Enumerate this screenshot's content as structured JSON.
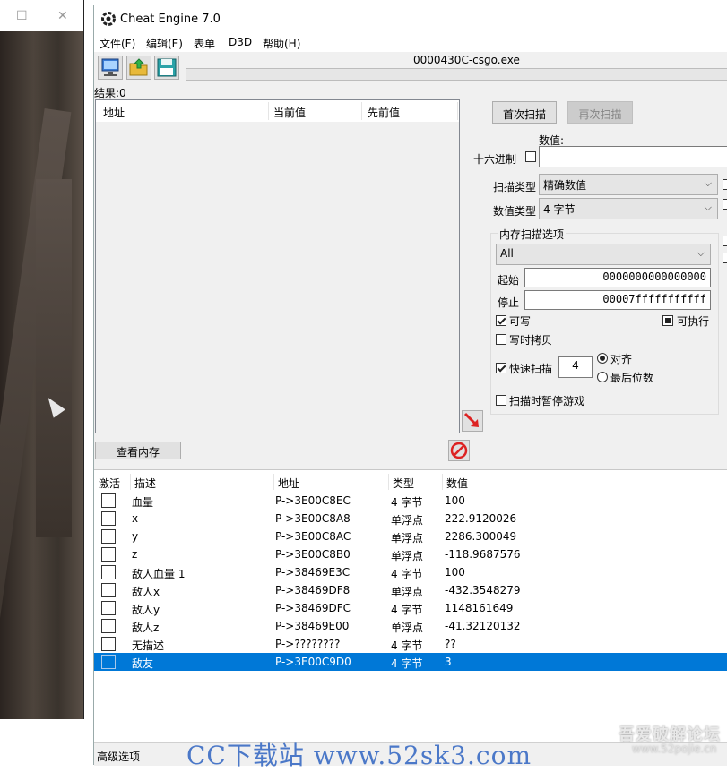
{
  "window": {
    "title": "Cheat Engine 7.0",
    "process": "0000430C-csgo.exe"
  },
  "menu": [
    "文件(F)",
    "编辑(E)",
    "表单",
    "D3D",
    "帮助(H)"
  ],
  "results_label": "结果:0",
  "found_list": {
    "columns": [
      "地址",
      "当前值",
      "先前值"
    ]
  },
  "view_memory_label": "查看内存",
  "scan": {
    "first_scan": "首次扫描",
    "next_scan": "再次扫描",
    "value_label": "数值:",
    "hex_label": "十六进制",
    "hex_checked": false,
    "value": "",
    "scan_type_label": "扫描类型",
    "scan_type": "精确数值",
    "value_type_label": "数值类型",
    "value_type": "4 字节",
    "memory_group_title": "内存扫描选项",
    "region": "All",
    "start_label": "起始",
    "start_value": "0000000000000000",
    "stop_label": "停止",
    "stop_value": "00007fffffffffff",
    "writable_label": "可写",
    "writable": true,
    "executable_label": "可执行",
    "executable": "partial",
    "copy_on_write_label": "写时拷贝",
    "copy_on_write": false,
    "fast_scan_label": "快速扫描",
    "fast_scan": true,
    "fast_scan_value": "4",
    "align_label": "对齐",
    "last_digits_label": "最后位数",
    "alignment_selected": "对齐",
    "pause_label": "扫描时暂停游戏",
    "pause": false
  },
  "address_list": {
    "columns": [
      "激活",
      "描述",
      "地址",
      "类型",
      "数值"
    ],
    "rows": [
      {
        "active": false,
        "desc": "血量",
        "address": "P->3E00C8EC",
        "type": "4 字节",
        "value": "100"
      },
      {
        "active": false,
        "desc": "x",
        "address": "P->3E00C8A8",
        "type": "单浮点",
        "value": "222.9120026"
      },
      {
        "active": false,
        "desc": "y",
        "address": "P->3E00C8AC",
        "type": "单浮点",
        "value": "2286.300049"
      },
      {
        "active": false,
        "desc": "z",
        "address": "P->3E00C8B0",
        "type": "单浮点",
        "value": "-118.9687576"
      },
      {
        "active": false,
        "desc": "敌人血量 1",
        "address": "P->38469E3C",
        "type": "4 字节",
        "value": "100"
      },
      {
        "active": false,
        "desc": "敌人x",
        "address": "P->38469DF8",
        "type": "单浮点",
        "value": "-432.3548279"
      },
      {
        "active": false,
        "desc": "敌人y",
        "address": "P->38469DFC",
        "type": "4 字节",
        "value": "1148161649"
      },
      {
        "active": false,
        "desc": "敌人z",
        "address": "P->38469E00",
        "type": "单浮点",
        "value": "-41.32120132"
      },
      {
        "active": false,
        "desc": "无描述",
        "address": "P->????????",
        "type": "4 字节",
        "value": "??"
      },
      {
        "active": false,
        "desc": "敌友",
        "address": "P->3E00C9D0",
        "type": "4 字节",
        "value": "3",
        "selected": true
      }
    ]
  },
  "status_left": "高级选项",
  "watermark": {
    "main": "CC下载站 www.52sk3.com",
    "right_cn": "吾爱破解论坛",
    "right_url": "www.52pojie.cn"
  },
  "colors": {
    "selection": "#0078d7",
    "watermark": "#4b78c8"
  }
}
